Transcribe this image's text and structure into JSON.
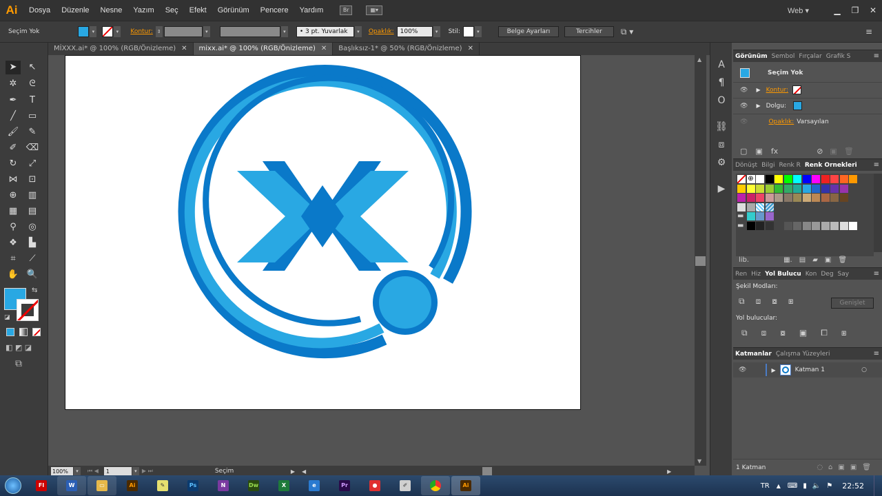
{
  "app": {
    "logo": "Ai",
    "workspace": "Web ▾"
  },
  "menu": [
    "Dosya",
    "Düzenle",
    "Nesne",
    "Yazım",
    "Seç",
    "Efekt",
    "Görünüm",
    "Pencere",
    "Yardım"
  ],
  "control": {
    "selection": "Seçim Yok",
    "stroke_label": "Kontur:",
    "brush": "3 pt. Yuvarlak",
    "opacity_label": "Opaklık:",
    "opacity_value": "100%",
    "style_label": "Stil:",
    "doc_settings": "Belge Ayarları",
    "prefs": "Tercihler"
  },
  "tabs": [
    {
      "label": "MİXXX.ai* @ 100% (RGB/Önizleme)"
    },
    {
      "label": "mixx.ai* @ 100% (RGB/Önizleme)"
    },
    {
      "label": "Başlıksız-1* @ 50% (RGB/Önizleme)"
    }
  ],
  "status": {
    "zoom": "100%",
    "page": "1",
    "tool": "Seçim"
  },
  "appearance": {
    "tabs": [
      "Görünüm",
      "Sembol",
      "Fırçalar",
      "Grafik S"
    ],
    "title": "Seçim Yok",
    "stroke": "Kontur:",
    "fill": "Dolgu:",
    "opacity": "Opaklık:",
    "opacity_val": "Varsayılan"
  },
  "swatches": {
    "tabs": [
      "Dönüşt",
      "Bilgi",
      "Renk R",
      "Renk Örnekleri"
    ]
  },
  "pathfinder": {
    "tabs": [
      "Ren",
      "Hiz",
      "Yol Bulucu",
      "Kon",
      "Deg",
      "Say"
    ],
    "shape_modes": "Şekil Modları:",
    "expand": "Genişlet",
    "pathfinders": "Yol bulucular:"
  },
  "layers": {
    "tabs": [
      "Katmanlar",
      "Çalışma Yüzeyleri"
    ],
    "layer1": "Katman 1",
    "count": "1 Katman"
  },
  "taskbar": {
    "lang": "TR",
    "time": "22:52"
  },
  "colors": {
    "logo_dark": "#0a79c9",
    "logo_light": "#29a8e3",
    "accent": "#ff9a00"
  }
}
